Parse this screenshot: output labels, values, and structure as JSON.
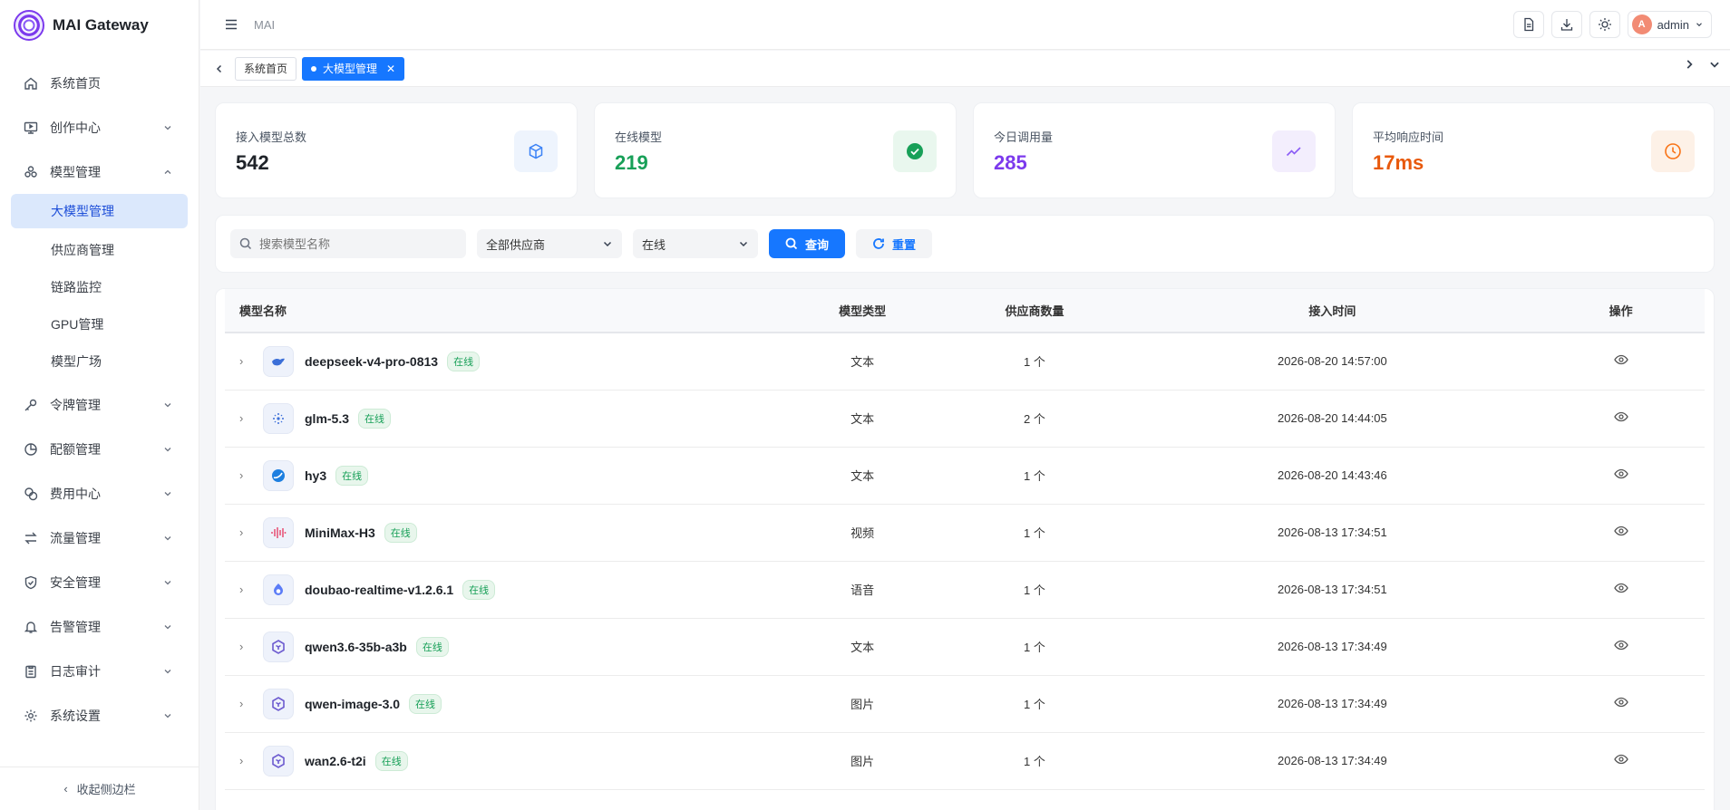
{
  "app": {
    "title": "MAI Gateway"
  },
  "header": {
    "breadcrumb": "MAI",
    "user": {
      "initial": "A",
      "name": "admin"
    }
  },
  "sidebar": {
    "items": [
      {
        "label": "系统首页",
        "icon": "home-icon"
      },
      {
        "label": "创作中心",
        "icon": "monitor-icon"
      },
      {
        "label": "模型管理",
        "icon": "cluster-icon"
      },
      {
        "label": "令牌管理",
        "icon": "key-icon"
      },
      {
        "label": "配额管理",
        "icon": "pie-icon"
      },
      {
        "label": "费用中心",
        "icon": "coins-icon"
      },
      {
        "label": "流量管理",
        "icon": "swap-icon"
      },
      {
        "label": "安全管理",
        "icon": "shield-icon"
      },
      {
        "label": "告警管理",
        "icon": "bell-icon"
      },
      {
        "label": "日志审计",
        "icon": "clipboard-icon"
      },
      {
        "label": "系统设置",
        "icon": "gear-icon"
      }
    ],
    "model_sub": [
      "大模型管理",
      "供应商管理",
      "链路监控",
      "GPU管理",
      "模型广场"
    ],
    "collapse_label": "收起侧边栏"
  },
  "tabs": [
    {
      "label": "系统首页"
    },
    {
      "label": "大模型管理"
    }
  ],
  "stats": [
    {
      "label": "接入模型总数",
      "value": "542",
      "color": "#1f2329",
      "bg": "#eef4fd",
      "icon": "cube-icon"
    },
    {
      "label": "在线模型",
      "value": "219",
      "color": "#18a058",
      "bg": "#e9f7ee",
      "icon": "check-circle-icon"
    },
    {
      "label": "今日调用量",
      "value": "285",
      "color": "#7c3aed",
      "bg": "#f3eefd",
      "icon": "trend-icon"
    },
    {
      "label": "平均响应时间",
      "value": "17ms",
      "color": "#e8590c",
      "bg": "#fdf1e7",
      "icon": "clock-icon"
    }
  ],
  "filters": {
    "search_placeholder": "搜索模型名称",
    "provider": "全部供应商",
    "status": "在线",
    "query_label": "查询",
    "reset_label": "重置"
  },
  "table": {
    "columns": [
      "模型名称",
      "模型类型",
      "供应商数量",
      "接入时间",
      "操作"
    ],
    "rows": [
      {
        "name": "deepseek-v4-pro-0813",
        "status": "在线",
        "type": "文本",
        "providers": "1 个",
        "time": "2026-08-20 14:57:00",
        "icon": "whale-icon"
      },
      {
        "name": "glm-5.3",
        "status": "在线",
        "type": "文本",
        "providers": "2 个",
        "time": "2026-08-20 14:44:05",
        "icon": "dots-icon"
      },
      {
        "name": "hy3",
        "status": "在线",
        "type": "文本",
        "providers": "1 个",
        "time": "2026-08-20 14:43:46",
        "icon": "orb-icon"
      },
      {
        "name": "MiniMax-H3",
        "status": "在线",
        "type": "视频",
        "providers": "1 个",
        "time": "2026-08-13 17:34:51",
        "icon": "wave-icon"
      },
      {
        "name": "doubao-realtime-v1.2.6.1",
        "status": "在线",
        "type": "语音",
        "providers": "1 个",
        "time": "2026-08-13 17:34:51",
        "icon": "droplet-icon"
      },
      {
        "name": "qwen3.6-35b-a3b",
        "status": "在线",
        "type": "文本",
        "providers": "1 个",
        "time": "2026-08-13 17:34:49",
        "icon": "qwen-icon"
      },
      {
        "name": "qwen-image-3.0",
        "status": "在线",
        "type": "图片",
        "providers": "1 个",
        "time": "2026-08-13 17:34:49",
        "icon": "qwen-icon"
      },
      {
        "name": "wan2.6-t2i",
        "status": "在线",
        "type": "图片",
        "providers": "1 个",
        "time": "2026-08-13 17:34:49",
        "icon": "qwen-icon"
      }
    ]
  }
}
